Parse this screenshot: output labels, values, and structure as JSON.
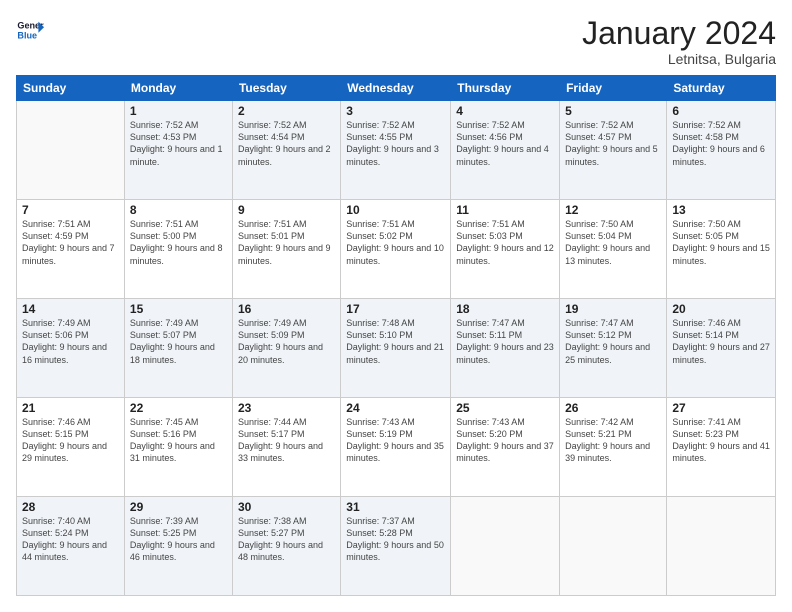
{
  "logo": {
    "line1": "General",
    "line2": "Blue"
  },
  "title": "January 2024",
  "location": "Letnitsa, Bulgaria",
  "weekdays": [
    "Sunday",
    "Monday",
    "Tuesday",
    "Wednesday",
    "Thursday",
    "Friday",
    "Saturday"
  ],
  "weeks": [
    [
      {
        "day": "",
        "sunrise": "",
        "sunset": "",
        "daylight": ""
      },
      {
        "day": "1",
        "sunrise": "Sunrise: 7:52 AM",
        "sunset": "Sunset: 4:53 PM",
        "daylight": "Daylight: 9 hours and 1 minute."
      },
      {
        "day": "2",
        "sunrise": "Sunrise: 7:52 AM",
        "sunset": "Sunset: 4:54 PM",
        "daylight": "Daylight: 9 hours and 2 minutes."
      },
      {
        "day": "3",
        "sunrise": "Sunrise: 7:52 AM",
        "sunset": "Sunset: 4:55 PM",
        "daylight": "Daylight: 9 hours and 3 minutes."
      },
      {
        "day": "4",
        "sunrise": "Sunrise: 7:52 AM",
        "sunset": "Sunset: 4:56 PM",
        "daylight": "Daylight: 9 hours and 4 minutes."
      },
      {
        "day": "5",
        "sunrise": "Sunrise: 7:52 AM",
        "sunset": "Sunset: 4:57 PM",
        "daylight": "Daylight: 9 hours and 5 minutes."
      },
      {
        "day": "6",
        "sunrise": "Sunrise: 7:52 AM",
        "sunset": "Sunset: 4:58 PM",
        "daylight": "Daylight: 9 hours and 6 minutes."
      }
    ],
    [
      {
        "day": "7",
        "sunrise": "Sunrise: 7:51 AM",
        "sunset": "Sunset: 4:59 PM",
        "daylight": "Daylight: 9 hours and 7 minutes."
      },
      {
        "day": "8",
        "sunrise": "Sunrise: 7:51 AM",
        "sunset": "Sunset: 5:00 PM",
        "daylight": "Daylight: 9 hours and 8 minutes."
      },
      {
        "day": "9",
        "sunrise": "Sunrise: 7:51 AM",
        "sunset": "Sunset: 5:01 PM",
        "daylight": "Daylight: 9 hours and 9 minutes."
      },
      {
        "day": "10",
        "sunrise": "Sunrise: 7:51 AM",
        "sunset": "Sunset: 5:02 PM",
        "daylight": "Daylight: 9 hours and 10 minutes."
      },
      {
        "day": "11",
        "sunrise": "Sunrise: 7:51 AM",
        "sunset": "Sunset: 5:03 PM",
        "daylight": "Daylight: 9 hours and 12 minutes."
      },
      {
        "day": "12",
        "sunrise": "Sunrise: 7:50 AM",
        "sunset": "Sunset: 5:04 PM",
        "daylight": "Daylight: 9 hours and 13 minutes."
      },
      {
        "day": "13",
        "sunrise": "Sunrise: 7:50 AM",
        "sunset": "Sunset: 5:05 PM",
        "daylight": "Daylight: 9 hours and 15 minutes."
      }
    ],
    [
      {
        "day": "14",
        "sunrise": "Sunrise: 7:49 AM",
        "sunset": "Sunset: 5:06 PM",
        "daylight": "Daylight: 9 hours and 16 minutes."
      },
      {
        "day": "15",
        "sunrise": "Sunrise: 7:49 AM",
        "sunset": "Sunset: 5:07 PM",
        "daylight": "Daylight: 9 hours and 18 minutes."
      },
      {
        "day": "16",
        "sunrise": "Sunrise: 7:49 AM",
        "sunset": "Sunset: 5:09 PM",
        "daylight": "Daylight: 9 hours and 20 minutes."
      },
      {
        "day": "17",
        "sunrise": "Sunrise: 7:48 AM",
        "sunset": "Sunset: 5:10 PM",
        "daylight": "Daylight: 9 hours and 21 minutes."
      },
      {
        "day": "18",
        "sunrise": "Sunrise: 7:47 AM",
        "sunset": "Sunset: 5:11 PM",
        "daylight": "Daylight: 9 hours and 23 minutes."
      },
      {
        "day": "19",
        "sunrise": "Sunrise: 7:47 AM",
        "sunset": "Sunset: 5:12 PM",
        "daylight": "Daylight: 9 hours and 25 minutes."
      },
      {
        "day": "20",
        "sunrise": "Sunrise: 7:46 AM",
        "sunset": "Sunset: 5:14 PM",
        "daylight": "Daylight: 9 hours and 27 minutes."
      }
    ],
    [
      {
        "day": "21",
        "sunrise": "Sunrise: 7:46 AM",
        "sunset": "Sunset: 5:15 PM",
        "daylight": "Daylight: 9 hours and 29 minutes."
      },
      {
        "day": "22",
        "sunrise": "Sunrise: 7:45 AM",
        "sunset": "Sunset: 5:16 PM",
        "daylight": "Daylight: 9 hours and 31 minutes."
      },
      {
        "day": "23",
        "sunrise": "Sunrise: 7:44 AM",
        "sunset": "Sunset: 5:17 PM",
        "daylight": "Daylight: 9 hours and 33 minutes."
      },
      {
        "day": "24",
        "sunrise": "Sunrise: 7:43 AM",
        "sunset": "Sunset: 5:19 PM",
        "daylight": "Daylight: 9 hours and 35 minutes."
      },
      {
        "day": "25",
        "sunrise": "Sunrise: 7:43 AM",
        "sunset": "Sunset: 5:20 PM",
        "daylight": "Daylight: 9 hours and 37 minutes."
      },
      {
        "day": "26",
        "sunrise": "Sunrise: 7:42 AM",
        "sunset": "Sunset: 5:21 PM",
        "daylight": "Daylight: 9 hours and 39 minutes."
      },
      {
        "day": "27",
        "sunrise": "Sunrise: 7:41 AM",
        "sunset": "Sunset: 5:23 PM",
        "daylight": "Daylight: 9 hours and 41 minutes."
      }
    ],
    [
      {
        "day": "28",
        "sunrise": "Sunrise: 7:40 AM",
        "sunset": "Sunset: 5:24 PM",
        "daylight": "Daylight: 9 hours and 44 minutes."
      },
      {
        "day": "29",
        "sunrise": "Sunrise: 7:39 AM",
        "sunset": "Sunset: 5:25 PM",
        "daylight": "Daylight: 9 hours and 46 minutes."
      },
      {
        "day": "30",
        "sunrise": "Sunrise: 7:38 AM",
        "sunset": "Sunset: 5:27 PM",
        "daylight": "Daylight: 9 hours and 48 minutes."
      },
      {
        "day": "31",
        "sunrise": "Sunrise: 7:37 AM",
        "sunset": "Sunset: 5:28 PM",
        "daylight": "Daylight: 9 hours and 50 minutes."
      },
      {
        "day": "",
        "sunrise": "",
        "sunset": "",
        "daylight": ""
      },
      {
        "day": "",
        "sunrise": "",
        "sunset": "",
        "daylight": ""
      },
      {
        "day": "",
        "sunrise": "",
        "sunset": "",
        "daylight": ""
      }
    ]
  ]
}
